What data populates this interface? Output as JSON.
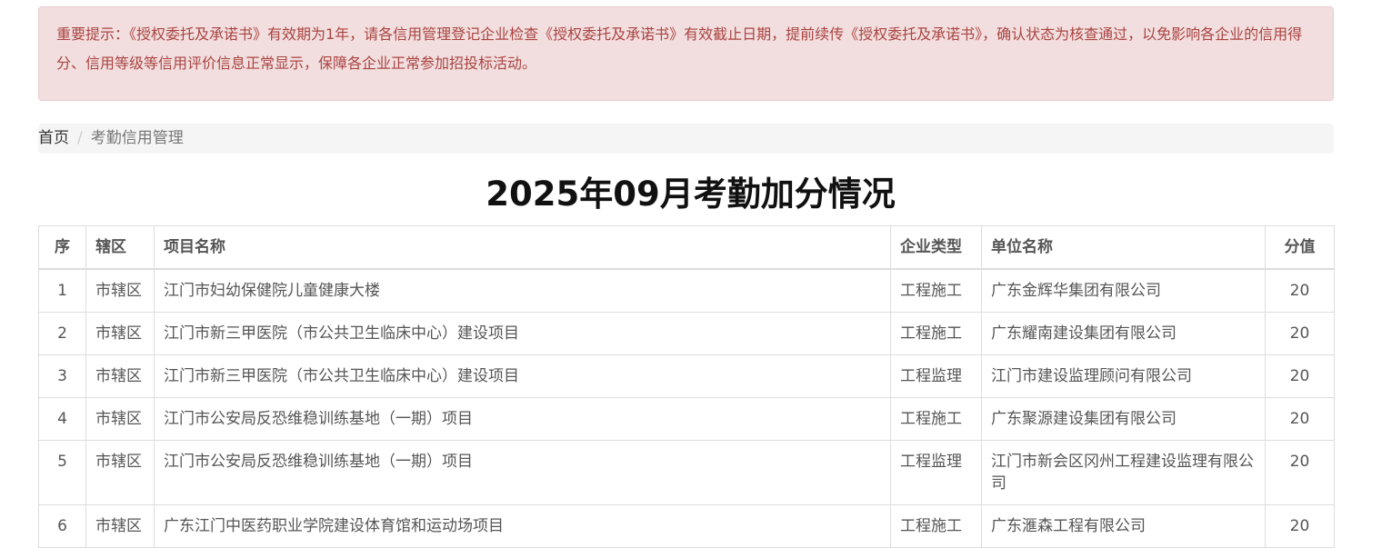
{
  "alert": {
    "text": "重要提示：《授权委托及承诺书》有效期为1年，请各信用管理登记企业检查《授权委托及承诺书》有效截止日期，提前续传《授权委托及承诺书》，确认状态为核查通过，以免影响各企业的信用得分、信用等级等信用评价信息正常显示，保障各企业正常参加招投标活动。"
  },
  "breadcrumb": {
    "home": "首页",
    "separator": "/",
    "current": "考勤信用管理"
  },
  "page": {
    "title": "2025年09月考勤加分情况"
  },
  "table": {
    "headers": {
      "index": "序",
      "district": "辖区",
      "project": "项目名称",
      "type": "企业类型",
      "company": "单位名称",
      "score": "分值"
    },
    "rows": [
      {
        "index": "1",
        "district": "市辖区",
        "project": "江门市妇幼保健院儿童健康大楼",
        "type": "工程施工",
        "company": "广东金辉华集团有限公司",
        "score": "20"
      },
      {
        "index": "2",
        "district": "市辖区",
        "project": "江门市新三甲医院（市公共卫生临床中心）建设项目",
        "type": "工程施工",
        "company": "广东耀南建设集团有限公司",
        "score": "20"
      },
      {
        "index": "3",
        "district": "市辖区",
        "project": "江门市新三甲医院（市公共卫生临床中心）建设项目",
        "type": "工程监理",
        "company": "江门市建设监理顾问有限公司",
        "score": "20"
      },
      {
        "index": "4",
        "district": "市辖区",
        "project": "江门市公安局反恐维稳训练基地（一期）项目",
        "type": "工程施工",
        "company": "广东聚源建设集团有限公司",
        "score": "20"
      },
      {
        "index": "5",
        "district": "市辖区",
        "project": "江门市公安局反恐维稳训练基地（一期）项目",
        "type": "工程监理",
        "company": "江门市新会区冈州工程建设监理有限公司",
        "score": "20"
      },
      {
        "index": "6",
        "district": "市辖区",
        "project": "广东江门中医药职业学院建设体育馆和运动场项目",
        "type": "工程施工",
        "company": "广东滙森工程有限公司",
        "score": "20"
      }
    ]
  }
}
